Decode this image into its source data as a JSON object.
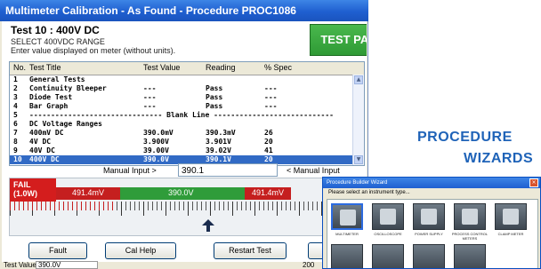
{
  "window": {
    "title": "Multimeter Calibration - As Found - Procedure PROC1086"
  },
  "test": {
    "heading": "Test 10 : 400V DC",
    "select_range": "SELECT 400VDC RANGE",
    "instruction": "Enter value displayed on meter (without units).",
    "result_badge": "TEST PASSED"
  },
  "grid": {
    "columns": [
      "No.",
      "Test Title",
      "Test Value",
      "Reading",
      "% Spec"
    ],
    "rows": [
      {
        "no": "1",
        "title": "General Tests",
        "value": "",
        "reading": "",
        "spec": ""
      },
      {
        "no": "2",
        "title": "Continuity Bleeper",
        "value": "---",
        "reading": "Pass",
        "spec": "---"
      },
      {
        "no": "3",
        "title": "Diode Test",
        "value": "---",
        "reading": "Pass",
        "spec": "---"
      },
      {
        "no": "4",
        "title": "Bar Graph",
        "value": "---",
        "reading": "Pass",
        "spec": "---"
      },
      {
        "no": "5",
        "title": "------------------------------- Blank Line ----------------------------",
        "value": "",
        "reading": "",
        "spec": ""
      },
      {
        "no": "6",
        "title": "DC Voltage Ranges",
        "value": "",
        "reading": "",
        "spec": ""
      },
      {
        "no": "7",
        "title": "400mV DC",
        "value": "390.0mV",
        "reading": "390.3mV",
        "spec": "26"
      },
      {
        "no": "8",
        "title": "4V DC",
        "value": "3.900V",
        "reading": "3.901V",
        "spec": "20"
      },
      {
        "no": "9",
        "title": "40V DC",
        "value": "39.00V",
        "reading": "39.02V",
        "spec": "41"
      },
      {
        "no": "10",
        "title": "400V DC",
        "value": "390.0V",
        "reading": "390.1V",
        "spec": "20"
      }
    ],
    "selected_row": "10"
  },
  "manual_input": {
    "label": "Manual Input >",
    "value": "390.1",
    "label_right": "< Manual Input"
  },
  "gauge": {
    "fail_label": "FAIL",
    "fail_sub": "(1.0W)",
    "low_limit": "491.4mV",
    "center": "390.0V",
    "high_limit": "491.4mV",
    "reading_position_fraction": 0.56
  },
  "buttons": {
    "fault": "Fault",
    "cal_help": "Cal Help",
    "restart": "Restart Test",
    "next": "N"
  },
  "status": {
    "label": "Test Value",
    "value": "390.0V",
    "right": "200"
  },
  "hero": {
    "line1": "PROCEDURE",
    "line2": "WIZARDS"
  },
  "wizard": {
    "title": "Procedure Builder Wizard",
    "prompt": "Please select an instrument type...",
    "tiles": [
      {
        "label": "MULTIMETER",
        "icon": "multimeter-icon"
      },
      {
        "label": "OSCILLOSCOPE",
        "icon": "oscilloscope-icon"
      },
      {
        "label": "POWER SUPPLY",
        "icon": "power-supply-icon"
      },
      {
        "label": "PROCESS CONTROL METERS",
        "icon": "process-meter-icon"
      },
      {
        "label": "CLAMP METER",
        "icon": "clamp-meter-icon"
      }
    ]
  },
  "colors": {
    "pass_green": "#2f9a35",
    "fail_red": "#d41d1d",
    "hero_blue": "#1f63b8",
    "selection_blue": "#316ac5"
  }
}
